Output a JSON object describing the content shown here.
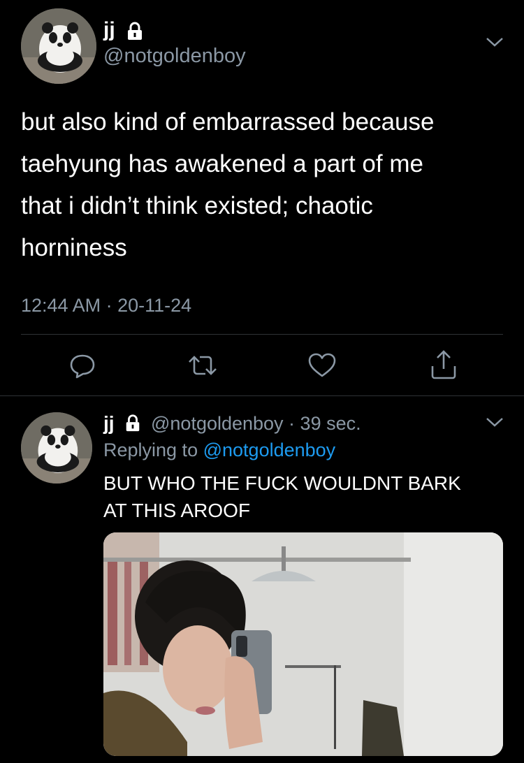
{
  "main_tweet": {
    "display_name": "jj",
    "handle": "@notgoldenboy",
    "text_lines": [
      "but also kind of embarrassed because",
      "taehyung has awakened a part of me",
      "that i didn’t think existed; chaotic",
      "horniness"
    ],
    "timestamp": "12:44 AM · 20-11-24"
  },
  "reply_tweet": {
    "display_name": "jj",
    "handle_time": "@notgoldenboy · 39 sec.",
    "replying_prefix": "Replying to",
    "replying_handle": "@notgoldenboy",
    "text_lines": [
      "BUT WHO THE FUCK WOULDNT BARK",
      "AT THIS AROOF"
    ]
  },
  "icons": {
    "lock": "lock-icon",
    "chevron": "chevron-down-icon",
    "reply": "reply-icon",
    "retweet": "retweet-icon",
    "like": "like-icon",
    "share": "share-icon"
  },
  "colors": {
    "background": "#000000",
    "muted": "#8b98a5",
    "link": "#1d9bf0"
  }
}
